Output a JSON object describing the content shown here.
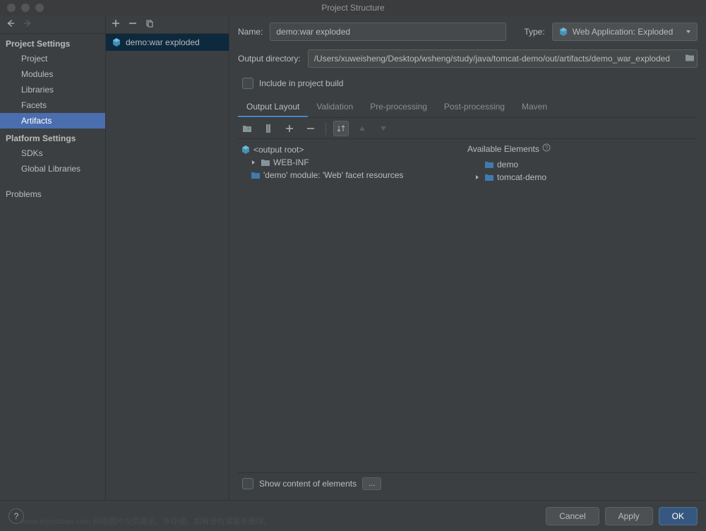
{
  "window": {
    "title": "Project Structure"
  },
  "sidebar": {
    "section_project": "Project Settings",
    "items_project": [
      "Project",
      "Modules",
      "Libraries",
      "Facets",
      "Artifacts"
    ],
    "section_platform": "Platform Settings",
    "items_platform": [
      "SDKs",
      "Global Libraries"
    ],
    "section_problems": "Problems"
  },
  "artifact_list": {
    "items": [
      {
        "label": "demo:war exploded"
      }
    ]
  },
  "form": {
    "name_label": "Name:",
    "name_value": "demo:war exploded",
    "type_label": "Type:",
    "type_value": "Web Application: Exploded",
    "outdir_label": "Output directory:",
    "outdir_value": "/Users/xuweisheng/Desktop/wsheng/study/java/tomcat-demo/out/artifacts/demo_war_exploded",
    "include_build_label": "Include in project build"
  },
  "tabs": [
    "Output Layout",
    "Validation",
    "Pre-processing",
    "Post-processing",
    "Maven"
  ],
  "output_tree": {
    "root": "<output root>",
    "web_inf": "WEB-INF",
    "facet": "'demo' module: 'Web' facet resources"
  },
  "available": {
    "header": "Available Elements",
    "items": [
      "demo",
      "tomcat-demo"
    ]
  },
  "show_content_label": "Show content of elements",
  "more_label": "...",
  "footer": {
    "cancel": "Cancel",
    "apply": "Apply",
    "ok": "OK"
  },
  "watermark": "www.toymoban.com 网络图片仅供展示，非存储，如有侵权请联系删除。"
}
